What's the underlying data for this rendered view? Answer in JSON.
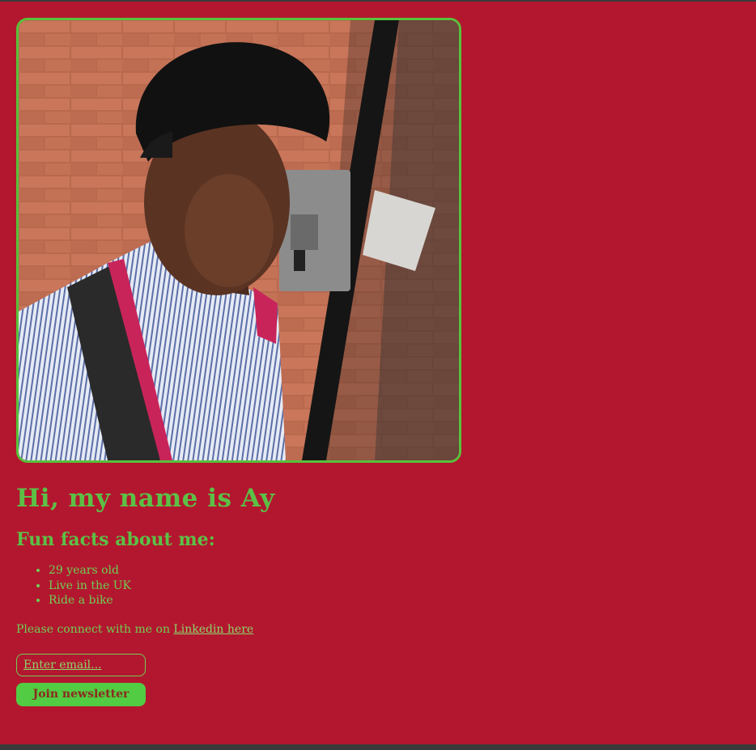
{
  "colors": {
    "page_background": "#b3172f",
    "accent_green": "#5cc046",
    "button_green": "#52cc42",
    "button_text": "#8a2a1f"
  },
  "profile": {
    "image_alt": "Profile photo"
  },
  "heading": "Hi, my name is Ay",
  "subheading": "Fun facts about me:",
  "facts": [
    "29 years old",
    "Live in the UK",
    "Ride a bike"
  ],
  "connect": {
    "prefix": "Please connect with me on ",
    "link_text": "Linkedin here"
  },
  "newsletter": {
    "email_placeholder": "Enter email...",
    "email_value": "",
    "button_label": "Join newsletter"
  }
}
